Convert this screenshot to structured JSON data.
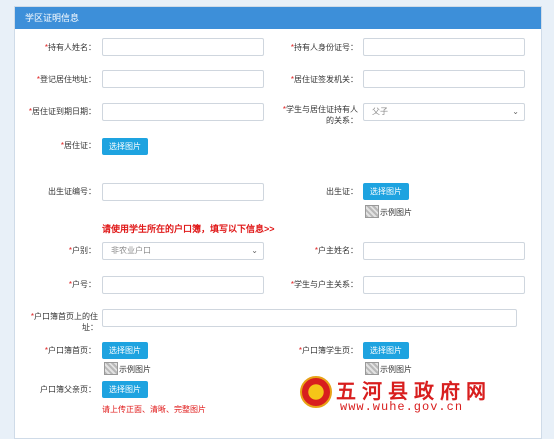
{
  "header": {
    "title": "学区证明信息"
  },
  "fields": {
    "holder_name": {
      "label": "持有人姓名：",
      "required": true
    },
    "holder_id": {
      "label": "持有人身份证号：",
      "required": true
    },
    "reg_address": {
      "label": "登记居住地址：",
      "required": true
    },
    "issuing_office": {
      "label": "居住证签发机关：",
      "required": true
    },
    "expiry_date": {
      "label": "居住证到期日期：",
      "required": true
    },
    "relation": {
      "label_line1": "学生与居住证持有人",
      "label_line2": "的关系：",
      "required": true,
      "value": "父子"
    },
    "residence_permit": {
      "label": "居住证：",
      "required": true
    },
    "birth_cert_no": {
      "label": "出生证编号："
    },
    "birth_cert": {
      "label": "出生证："
    },
    "household_type": {
      "label": "户别：",
      "required": true,
      "value": "非农业户口"
    },
    "head_name": {
      "label": "户主姓名：",
      "required": true
    },
    "household_no": {
      "label": "户号：",
      "required": true
    },
    "head_relation": {
      "label": "学生与户主关系：",
      "required": true
    },
    "hukou_address": {
      "label_line1": "户口簿首页上的住",
      "label_line2": "址：",
      "required": true
    },
    "hukou_first_page": {
      "label": "户口簿首页：",
      "required": true
    },
    "hukou_student_page": {
      "label": "户口簿学生页：",
      "required": true
    },
    "hukou_parent_page": {
      "label": "户口簿父亲页："
    }
  },
  "notice": "请使用学生所在的户口簿，填写以下信息>>",
  "upload_button_label": "选择图片",
  "sample_label": "示例图片",
  "upload_tip": "请上传正面、清晰、完整图片",
  "watermark": {
    "title": "五河县政府网",
    "url": "www.wuhe.gov.cn"
  }
}
